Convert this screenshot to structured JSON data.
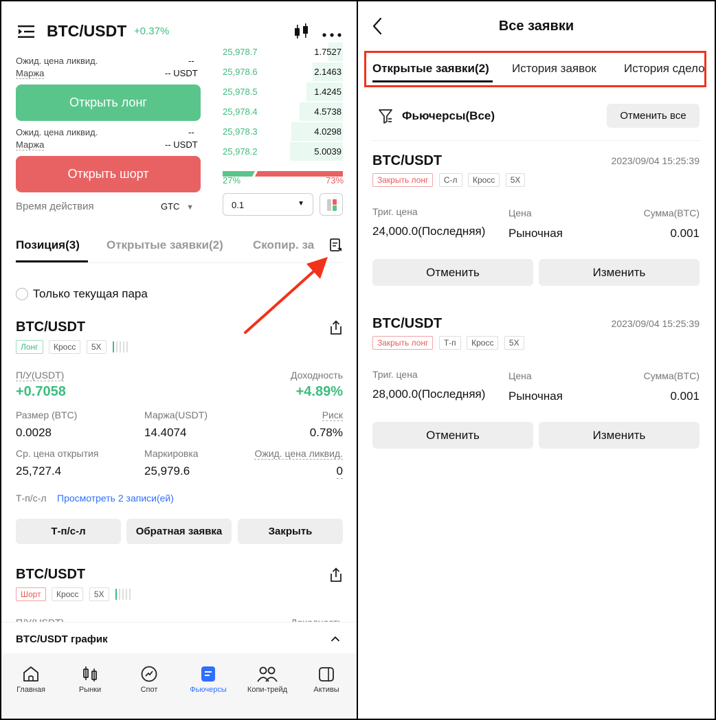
{
  "left": {
    "header": {
      "pair": "BTC/USDT",
      "change": "+0.37%"
    },
    "trade": {
      "liq_label_1": "Ожид. цена ликвид.",
      "liq_value_1": "--",
      "margin_label_1": "Маржа",
      "margin_value_1": "-- USDT",
      "open_long": "Открыть лонг",
      "liq_label_2": "Ожид. цена ликвид.",
      "liq_value_2": "--",
      "margin_label_2": "Маржа",
      "margin_value_2": "-- USDT",
      "open_short": "Открыть шорт",
      "tif_label": "Время действия",
      "tif_value": "GTC"
    },
    "orderbook": {
      "rows": [
        {
          "price": "25,978.7",
          "qty": "1.7527",
          "depth": 0.12
        },
        {
          "price": "25,978.6",
          "qty": "2.1463",
          "depth": 0.25
        },
        {
          "price": "25,978.5",
          "qty": "1.4245",
          "depth": 0.3
        },
        {
          "price": "25,978.4",
          "qty": "4.5738",
          "depth": 0.36
        },
        {
          "price": "25,978.3",
          "qty": "4.0298",
          "depth": 0.43
        },
        {
          "price": "25,978.2",
          "qty": "5.0039",
          "depth": 0.44
        }
      ],
      "buy_pct": "27%",
      "sell_pct": "73%",
      "buy_ratio": 0.27,
      "step_value": "0.1"
    },
    "tabs": [
      {
        "label": "Позиция(3)"
      },
      {
        "label": "Открытые заявки(2)"
      },
      {
        "label": "Скопир. за"
      }
    ],
    "only_current_pair": "Только текущая пара",
    "position1": {
      "pair": "BTC/USDT",
      "tag_side": "Лонг",
      "tag_mode": "Кросс",
      "tag_lev": "5X",
      "pnl_label": "П/У(USDT)",
      "pnl_value": "+0.7058",
      "yield_label": "Доходность",
      "yield_value": "+4.89%",
      "size_label": "Размер (BTC)",
      "size_value": "0.0028",
      "margin_label": "Маржа(USDT)",
      "margin_value": "14.4074",
      "risk_label": "Риск",
      "risk_value": "0.78%",
      "entry_label": "Ср. цена открытия",
      "entry_value": "25,727.4",
      "mark_label": "Маркировка",
      "mark_value": "25,979.6",
      "liq_label": "Ожид. цена ликвид.",
      "liq_value": "0",
      "tpsl_label": "Т-п/с-л",
      "tpsl_link": "Просмотреть 2 записи(ей)",
      "btn_tpsl": "Т-п/с-л",
      "btn_reverse": "Обратная заявка",
      "btn_close": "Закрыть"
    },
    "position2": {
      "pair": "BTC/USDT",
      "tag_side": "Шорт",
      "tag_mode": "Кросс",
      "tag_lev": "5X",
      "pnl_label": "П/У(USDT)",
      "yield_label": "Доходность"
    },
    "chart_bar": {
      "label": "BTC/USDT график"
    },
    "nav": [
      {
        "label": "Главная",
        "icon": "home-icon"
      },
      {
        "label": "Рынки",
        "icon": "candles-icon"
      },
      {
        "label": "Спот",
        "icon": "spot-icon"
      },
      {
        "label": "Фьючерсы",
        "icon": "futures-icon"
      },
      {
        "label": "Копи-трейд",
        "icon": "users-icon"
      },
      {
        "label": "Активы",
        "icon": "wallet-icon"
      }
    ],
    "colors": {
      "green": "#3dbd7d",
      "red": "#e85a5a",
      "accent": "#2f6fff",
      "annotation": "#f2321a"
    }
  },
  "right": {
    "title": "Все заявки",
    "tabs": [
      {
        "label": "Открытые заявки(2)"
      },
      {
        "label": "История заявок"
      },
      {
        "label": "История сдело"
      }
    ],
    "filter_label": "Фьючерсы(Все)",
    "cancel_all": "Отменить все",
    "orders": [
      {
        "pair": "BTC/USDT",
        "time": "2023/09/04 15:25:39",
        "tag_type": "Закрыть лонг",
        "tag_kind": "С-л",
        "tag_mode": "Кросс",
        "tag_lev": "5X",
        "trig_label": "Триг. цена",
        "trig_value": "24,000.0(Последняя)",
        "price_label": "Цена",
        "price_value": "Рыночная",
        "amount_label": "Сумма(BTC)",
        "amount_value": "0.001",
        "cancel": "Отменить",
        "edit": "Изменить"
      },
      {
        "pair": "BTC/USDT",
        "time": "2023/09/04 15:25:39",
        "tag_type": "Закрыть лонг",
        "tag_kind": "Т-п",
        "tag_mode": "Кросс",
        "tag_lev": "5X",
        "trig_label": "Триг. цена",
        "trig_value": "28,000.0(Последняя)",
        "price_label": "Цена",
        "price_value": "Рыночная",
        "amount_label": "Сумма(BTC)",
        "amount_value": "0.001",
        "cancel": "Отменить",
        "edit": "Изменить"
      }
    ]
  }
}
